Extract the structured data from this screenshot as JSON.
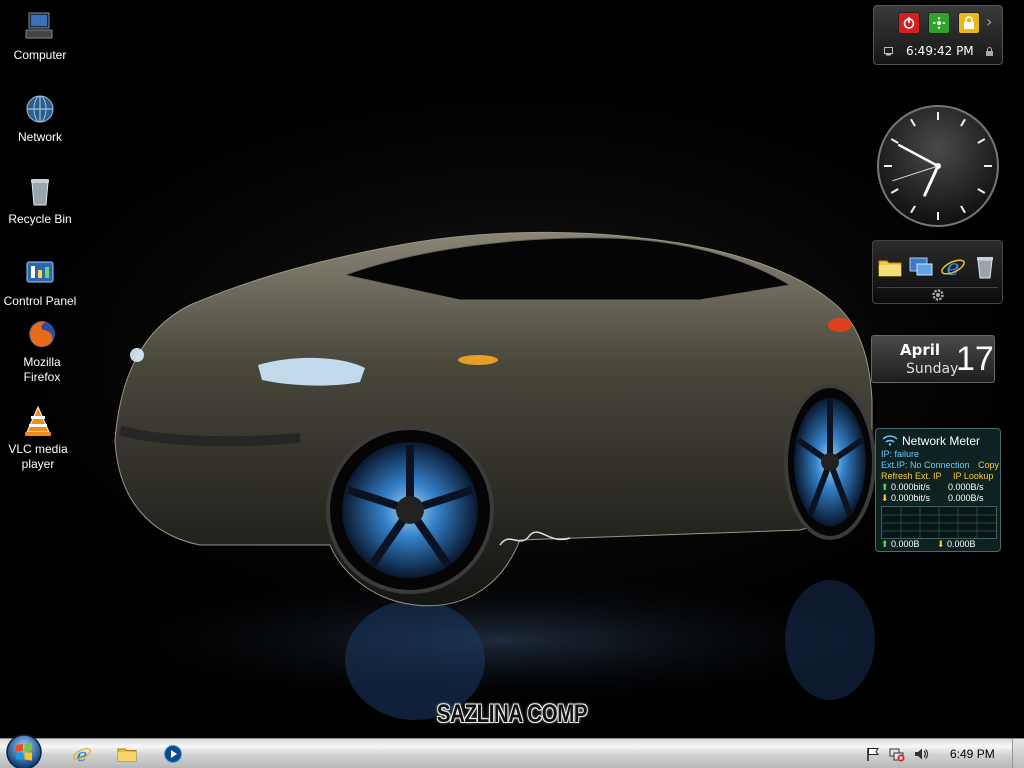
{
  "desktop": {
    "icons": [
      {
        "label": "Computer",
        "icon": "computer-icon"
      },
      {
        "label": "Network",
        "icon": "network-icon"
      },
      {
        "label": "Recycle Bin",
        "icon": "recycle-bin-icon"
      },
      {
        "label": "Control Panel",
        "icon": "control-panel-icon"
      },
      {
        "label": "Mozilla\nFirefox",
        "icon": "firefox-icon"
      },
      {
        "label": "VLC media\nplayer",
        "icon": "vlc-icon"
      }
    ],
    "wallpaper_caption": "SAZLINA COMP"
  },
  "gadgets": {
    "power": {
      "time": "6:49:42 PM",
      "buttons": [
        "power-icon",
        "restart-icon",
        "lock-icon"
      ],
      "colors": {
        "power": "#d42020",
        "restart": "#2ea42e",
        "lock": "#e8b81a"
      }
    },
    "clock": {
      "hour": 6,
      "minute": 49,
      "second": 42
    },
    "launcher": {
      "items": [
        "folder-icon",
        "remote-desktop-icon",
        "internet-explorer-icon",
        "recycle-bin-icon"
      ],
      "settings": "gear-icon"
    },
    "calendar": {
      "month": "April",
      "weekday": "Sunday",
      "day": "17"
    },
    "network_meter": {
      "title": "Network Meter",
      "ip": "IP: failure",
      "ext_ip_label": "Ext.IP: No Connection",
      "copy": "Copy",
      "refresh": "Refresh Ext. IP",
      "lookup": "IP Lookup",
      "up_rate_bits": "0.000bit/s",
      "up_rate_bytes": "0.000B/s",
      "down_rate_bits": "0.000bit/s",
      "down_rate_bytes": "0.000B/s",
      "total_up": "0.000B",
      "total_down": "0.000B"
    }
  },
  "taskbar": {
    "start": "start-orb-icon",
    "quick_launch": [
      "internet-explorer-icon",
      "folder-icon",
      "media-player-icon"
    ],
    "tray": [
      "flag-icon",
      "network-status-icon",
      "volume-icon"
    ],
    "clock": "6:49 PM"
  }
}
